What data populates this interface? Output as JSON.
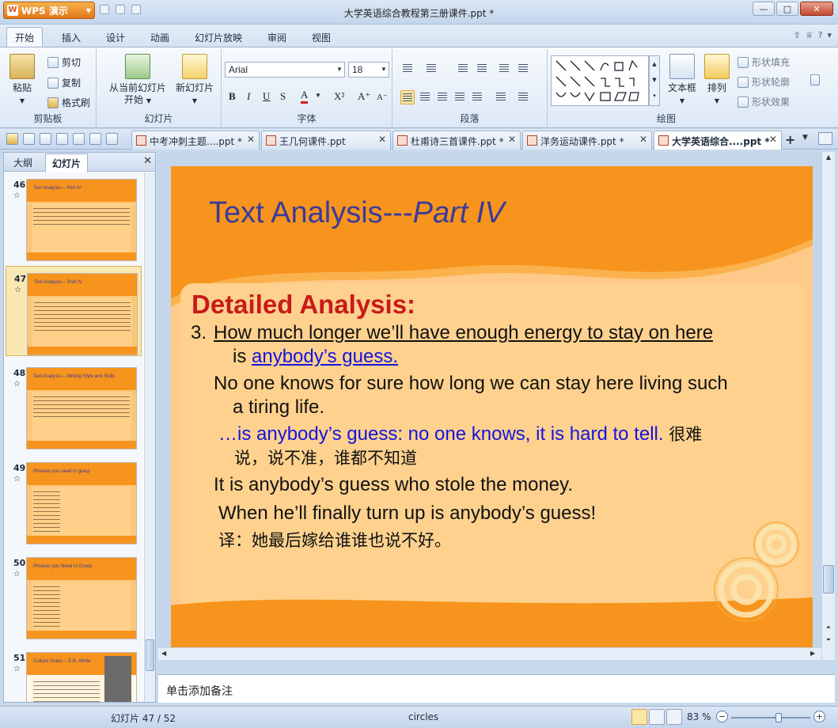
{
  "app": {
    "menu_label": "WPS 演示",
    "window_title": "大学英语综合教程第三册课件.ppt *"
  },
  "menu": {
    "tabs": [
      "开始",
      "插入",
      "设计",
      "动画",
      "幻灯片放映",
      "审阅",
      "视图"
    ]
  },
  "ribbon": {
    "clipboard": {
      "paste": "粘贴",
      "cut": "剪切",
      "copy": "复制",
      "format_painter": "格式刷",
      "label": "剪贴板"
    },
    "slides": {
      "from_current_1": "从当前幻灯片",
      "from_current_2": "开始",
      "new_slide": "新幻灯片",
      "label": "幻灯片"
    },
    "font": {
      "name": "Arial",
      "size": "18",
      "label": "字体"
    },
    "paragraph": {
      "label": "段落"
    },
    "drawing": {
      "textbox": "文本框",
      "arrange": "排列",
      "shape_fill": "形状填充",
      "shape_outline": "形状轮廓",
      "shape_effect": "形状效果",
      "label": "绘图"
    }
  },
  "doc_tabs": [
    {
      "label": "中考冲刺主题....ppt *"
    },
    {
      "label": "王几何课件.ppt"
    },
    {
      "label": "杜甫诗三首课件.ppt *"
    },
    {
      "label": "洋务运动课件.ppt *"
    },
    {
      "label": "大学英语综合....ppt *"
    }
  ],
  "left_pane": {
    "tabs": [
      "大纲",
      "幻灯片"
    ],
    "thumbnails": [
      {
        "num": "46",
        "title": "Text Analysis--- Part IV"
      },
      {
        "num": "47",
        "title": "Text Analysis--- Part IV"
      },
      {
        "num": "48",
        "title": "Text Analysis--- Writing Style and Skills"
      },
      {
        "num": "49",
        "title": "Phrases you need to grasp"
      },
      {
        "num": "50",
        "title": "Phrases you Need to Grasp"
      },
      {
        "num": "51",
        "title": "Culture Notes--- E.B. White"
      }
    ],
    "star": "☆"
  },
  "slide": {
    "title_main": "Text Analysis---",
    "title_italic": "Part IV",
    "heading": "Detailed Analysis:",
    "item_num": "3.",
    "q_line1": "How much longer we’ll have enough energy to stay on here",
    "q_line2_pre": "is ",
    "q_line2_link": "anybody’s guess.",
    "p1_line1": "No one knows for sure how long we can stay here living such",
    "p1_line2": "a tiring life.",
    "idiom_blue": "…is anybody’s guess: no one knows, it is hard to tell.",
    "idiom_cn1": " 很难",
    "idiom_cn2": "说，说不准，谁都不知道",
    "ex1": "It is anybody’s guess who stole the money.",
    "ex2": "When he’ll finally turn up is anybody’s guess!",
    "ex2_cn": "译：她最后嫁给谁谁也说不好。"
  },
  "notes": {
    "placeholder": "单击添加备注"
  },
  "status": {
    "slide_counter": "幻灯片 47 / 52",
    "theme": "circles",
    "zoom": "83 %",
    "zoom_fraction": 0.6
  }
}
